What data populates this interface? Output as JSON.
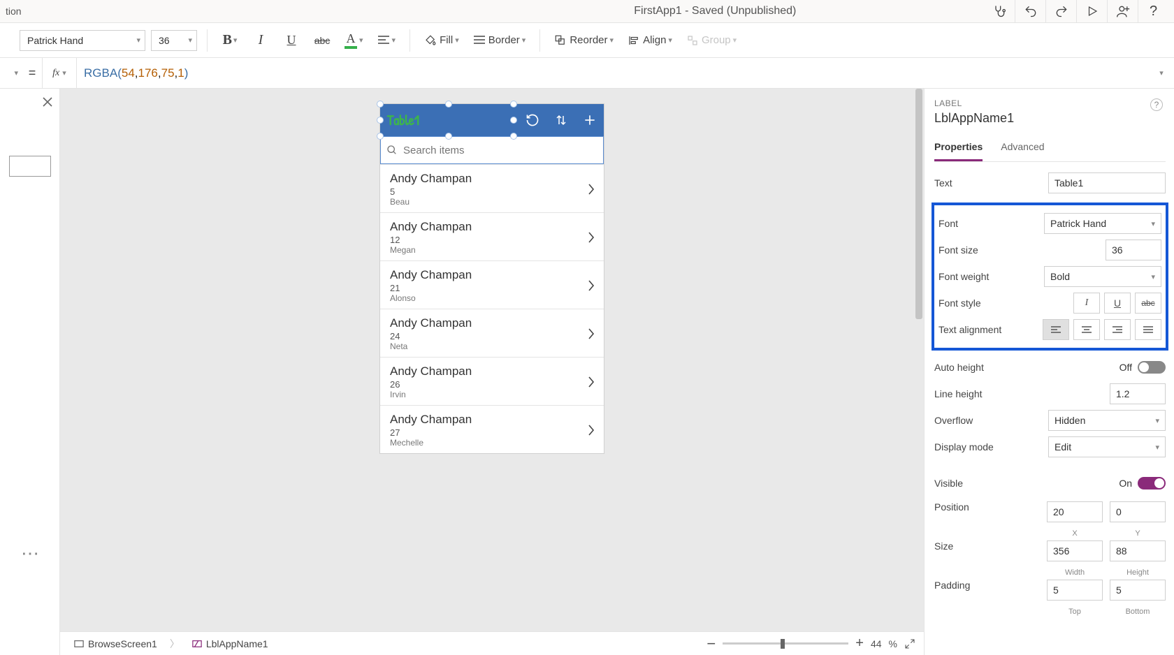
{
  "title_bar": {
    "left_fragment": "tion",
    "app_title": "FirstApp1 - Saved (Unpublished)"
  },
  "ribbon": {
    "font": "Patrick Hand",
    "font_size": "36",
    "fill_label": "Fill",
    "border_label": "Border",
    "reorder_label": "Reorder",
    "align_label": "Align",
    "group_label": "Group"
  },
  "formula": {
    "fn": "RGBA",
    "args": [
      "54",
      "176",
      "75",
      "1"
    ]
  },
  "canvas": {
    "app_title": "Table1",
    "search_placeholder": "Search items",
    "items": [
      {
        "name": "Andy Champan",
        "v": "5",
        "sub": "Beau"
      },
      {
        "name": "Andy Champan",
        "v": "12",
        "sub": "Megan"
      },
      {
        "name": "Andy Champan",
        "v": "21",
        "sub": "Alonso"
      },
      {
        "name": "Andy Champan",
        "v": "24",
        "sub": "Neta"
      },
      {
        "name": "Andy Champan",
        "v": "26",
        "sub": "Irvin"
      },
      {
        "name": "Andy Champan",
        "v": "27",
        "sub": "Mechelle"
      }
    ]
  },
  "breadcrumb": {
    "screen": "BrowseScreen1",
    "control": "LblAppName1"
  },
  "zoom": {
    "percent": "44",
    "unit": "%"
  },
  "props": {
    "category": "LABEL",
    "control": "LblAppName1",
    "tab_props": "Properties",
    "tab_adv": "Advanced",
    "text_lbl": "Text",
    "text_val": "Table1",
    "font_lbl": "Font",
    "font_val": "Patrick Hand",
    "fontsize_lbl": "Font size",
    "fontsize_val": "36",
    "fw_lbl": "Font weight",
    "fw_val": "Bold",
    "fs_lbl": "Font style",
    "ta_lbl": "Text alignment",
    "ah_lbl": "Auto height",
    "ah_state": "Off",
    "lh_lbl": "Line height",
    "lh_val": "1.2",
    "of_lbl": "Overflow",
    "of_val": "Hidden",
    "dm_lbl": "Display mode",
    "dm_val": "Edit",
    "vis_lbl": "Visible",
    "vis_state": "On",
    "pos_lbl": "Position",
    "pos_x": "20",
    "pos_y": "0",
    "pos_xl": "X",
    "pos_yl": "Y",
    "size_lbl": "Size",
    "size_w": "356",
    "size_h": "88",
    "size_wl": "Width",
    "size_hl": "Height",
    "pad_lbl": "Padding",
    "pad_t": "5",
    "pad_b": "5",
    "pad_tl": "Top",
    "pad_bl": "Bottom"
  }
}
